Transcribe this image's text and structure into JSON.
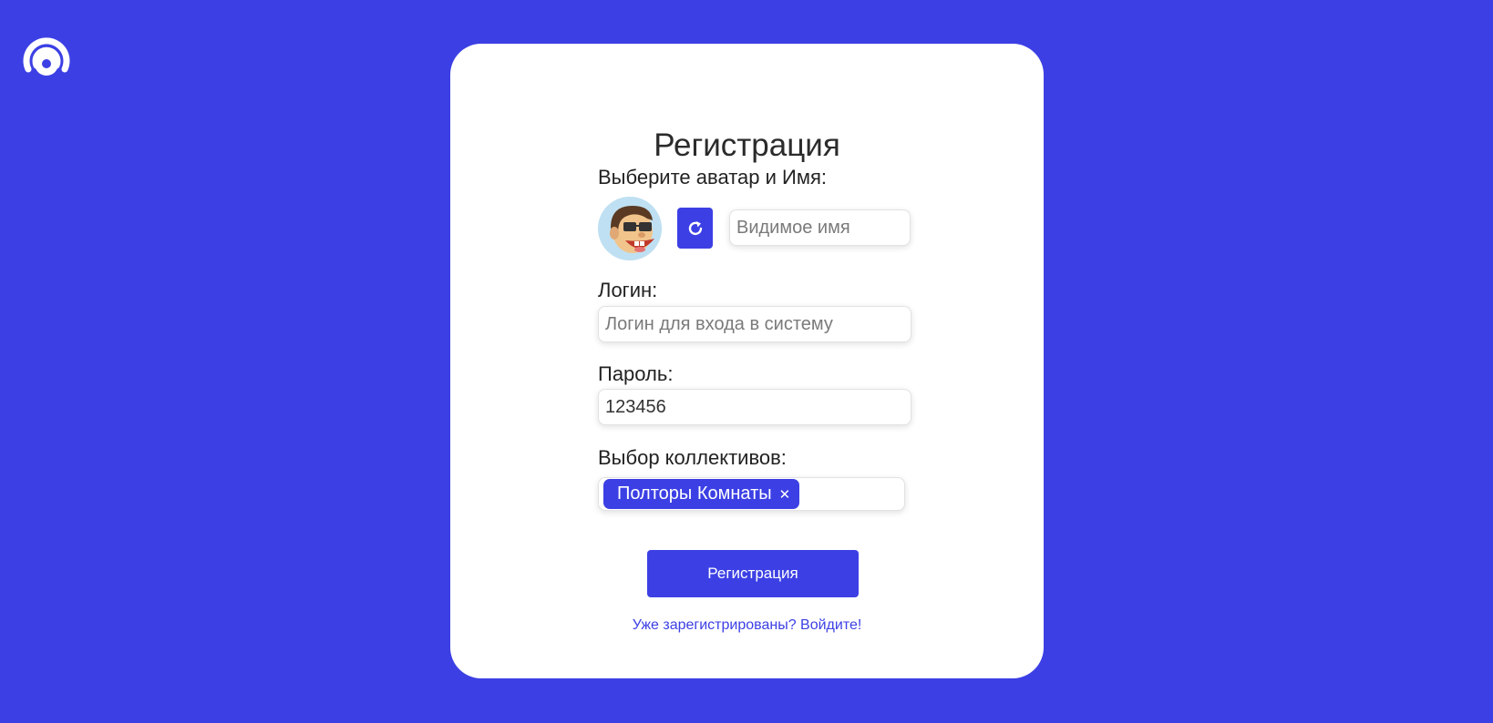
{
  "colors": {
    "background": "#3c40e4",
    "accent": "#3c40e4",
    "card": "#ffffff",
    "text": "#222222"
  },
  "header": {
    "logo_icon": "wifi-ring-logo-icon"
  },
  "form": {
    "title": "Регистрация",
    "avatar_label": "Выберите аватар и Имя:",
    "avatar_icon": "cartoon-avatar-icon",
    "refresh_icon": "refresh-icon",
    "name_placeholder": "Видимое имя",
    "name_value": "",
    "login_label": "Логин:",
    "login_placeholder": "Логин для входа в систему",
    "login_value": "",
    "password_label": "Пароль:",
    "password_placeholder": "",
    "password_value": "123456",
    "teams_label": "Выбор коллективов:",
    "teams_selected": [
      {
        "label": "Полторы Комнаты",
        "remove_icon": "close-icon",
        "remove_glyph": "✕"
      }
    ],
    "submit_label": "Регистрация",
    "login_link": "Уже зарегистрированы? Войдите!"
  }
}
